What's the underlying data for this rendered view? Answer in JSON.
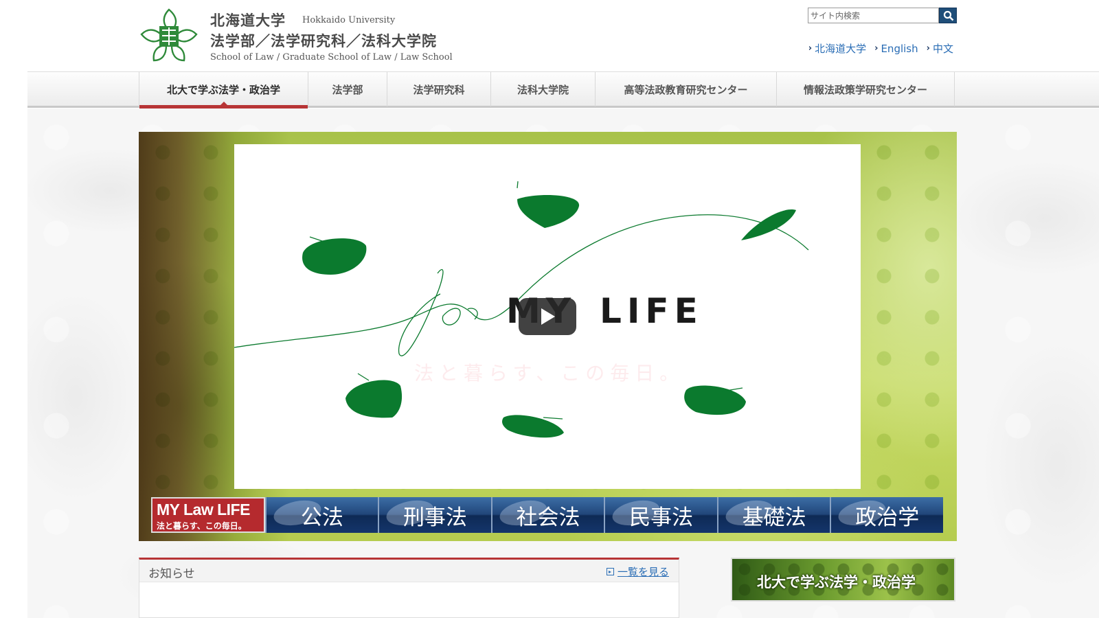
{
  "header": {
    "university_ja": "北海道大学",
    "university_en": "Hokkaido University",
    "school_ja": "法学部／法学研究科／法科大学院",
    "school_en": "School of Law / Graduate School of Law / Law School",
    "search": {
      "placeholder": "サイト内検索",
      "value": ""
    },
    "links": [
      {
        "label": "北海道大学"
      },
      {
        "label": "English"
      },
      {
        "label": "中文"
      }
    ]
  },
  "nav": {
    "items": [
      {
        "label": "北大で学ぶ法学・政治学",
        "active": true
      },
      {
        "label": "法学部"
      },
      {
        "label": "法学研究科"
      },
      {
        "label": "法科大学院"
      },
      {
        "label": "高等法政教育研究センター"
      },
      {
        "label": "情報法政策学研究センター"
      }
    ]
  },
  "hero": {
    "video_title_1": "MY",
    "video_title_2": "LIFE",
    "video_script": "for",
    "video_sub": "法と暮らす、この毎日。",
    "brand_title": "MY Law LIFE",
    "brand_sub": "法と暮らす、この毎日。",
    "categories": [
      "公法",
      "刑事法",
      "社会法",
      "民事法",
      "基礎法",
      "政治学"
    ]
  },
  "news": {
    "title": "お知らせ",
    "more_label": "一覧を見る"
  },
  "side_banner": {
    "label": "北大で学ぶ法学・政治学"
  },
  "colors": {
    "accent_red": "#b73435",
    "link_blue": "#2a6db5",
    "leaf_green": "#0b7a2e"
  }
}
